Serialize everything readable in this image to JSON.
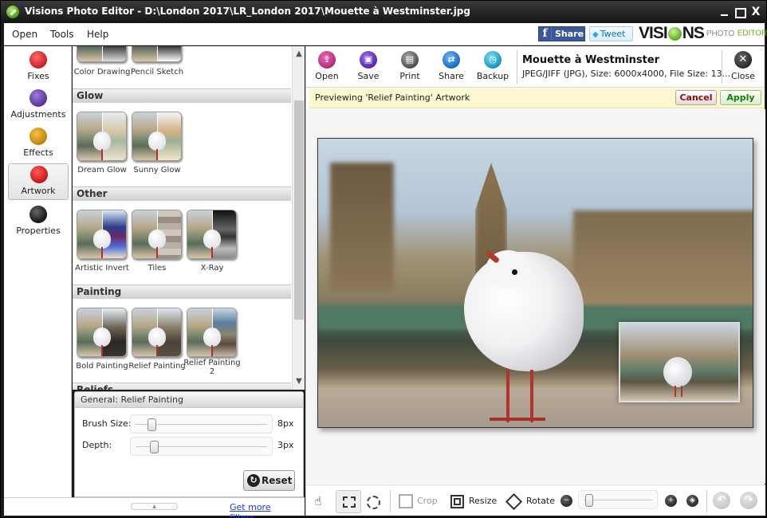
{
  "window": {
    "title": "Visions Photo Editor - D:\\London 2017\\LR_London 2017\\Mouette à Westminster.jpg",
    "controls": {
      "minimize": "minimize",
      "maximize": "maximize",
      "close": "X"
    }
  },
  "menu": {
    "items": [
      "Open",
      "Tools",
      "Help"
    ],
    "social": {
      "facebook_label": "Share",
      "twitter_label": "Tweet"
    },
    "brand": {
      "name_left": "VISI",
      "name_right": "NS",
      "sub1": "PHOTO",
      "sub2": "EDITOR"
    }
  },
  "sidebar": {
    "items": [
      {
        "label": "Fixes",
        "icon": "magic-wand-icon",
        "color": "#c8242c"
      },
      {
        "label": "Adjustments",
        "icon": "sliders-icon",
        "color": "#5a3a9a"
      },
      {
        "label": "Effects",
        "icon": "brush-icon",
        "color": "#c8860c"
      },
      {
        "label": "Artwork",
        "icon": "palette-icon",
        "color": "#c81c22",
        "active": true
      },
      {
        "label": "Properties",
        "icon": "document-icon",
        "color": "#1a1a1a"
      }
    ]
  },
  "filters": {
    "sections": [
      {
        "title": "",
        "items": [
          "Color Drawing",
          "Pencil Sketch"
        ]
      },
      {
        "title": "Glow",
        "items": [
          "Dream Glow",
          "Sunny Glow"
        ]
      },
      {
        "title": "Other",
        "items": [
          "Artistic Invert",
          "Tiles",
          "X-Ray"
        ]
      },
      {
        "title": "Painting",
        "items": [
          "Bold Painting",
          "Relief Painting",
          "Relief Painting 2"
        ]
      },
      {
        "title": "Reliefs",
        "items": []
      }
    ]
  },
  "settings": {
    "title": "General: Relief Painting",
    "brush_size": {
      "label": "Brush Size:",
      "value": "8px",
      "fraction": 0.1
    },
    "depth": {
      "label": "Depth:",
      "value": "3px",
      "fraction": 0.12
    },
    "reset_label": "Reset"
  },
  "footer": {
    "more_filters": "Get more filters..."
  },
  "toolbar": {
    "buttons": [
      {
        "label": "Open",
        "icon": "open-icon",
        "color": "#b8307e"
      },
      {
        "label": "Save",
        "icon": "save-icon",
        "color": "#5b2fae"
      },
      {
        "label": "Print",
        "icon": "print-icon",
        "color": "#555555"
      },
      {
        "label": "Share",
        "icon": "share-icon",
        "color": "#1f73c4"
      },
      {
        "label": "Backup",
        "icon": "backup-icon",
        "color": "#1e9cc0"
      }
    ],
    "file": {
      "name": "Mouette à Westminster",
      "meta": "JPEG/JIFF (JPG), Size: 6000x4000, File Size: 13..."
    },
    "close_label": "Close"
  },
  "preview": {
    "message": "Previewing 'Relief Painting' Artwork",
    "cancel_label": "Cancel",
    "apply_label": "Apply"
  },
  "bottom": {
    "crop_label": "Crop",
    "resize_label": "Resize",
    "rotate_label": "Rotate",
    "zoom_fraction": 0.02
  }
}
